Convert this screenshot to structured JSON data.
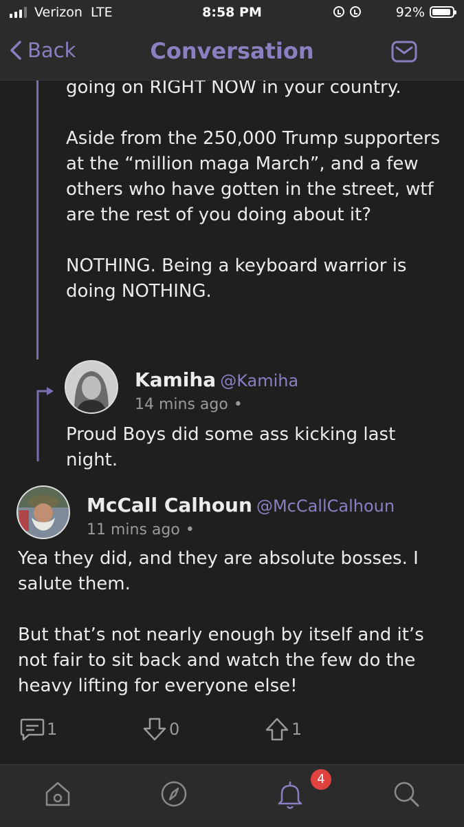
{
  "status_bar": {
    "carrier": "Verizon",
    "network": "LTE",
    "time": "8:58 PM",
    "battery_percent": "92%",
    "battery_level": 0.92,
    "signal_bars": 3,
    "icons": [
      "orientation-lock-icon",
      "alarm-icon"
    ]
  },
  "nav": {
    "back_label": "Back",
    "title": "Conversation",
    "compose_icon": "mail-icon"
  },
  "parent_post": {
    "paragraphs": [
      "going on RIGHT NOW in your country.",
      "Aside from the 250,000 Trump supporters at the “million maga March”, and a few others who have gotten in the street, wtf are the rest of you doing about it?",
      "NOTHING. Being a keyboard warrior is doing NOTHING."
    ]
  },
  "reply_one": {
    "name": "Kamiha",
    "handle": "@Kamiha",
    "time": "14 mins ago",
    "separator": "•",
    "text": "Proud Boys did some ass kicking last night."
  },
  "reply_two": {
    "name": "McCall Calhoun",
    "handle": "@McCallCalhoun",
    "time": "11 mins ago",
    "separator": "•",
    "paragraphs": [
      "Yea they did, and they are absolute bosses. I salute them.",
      "But that’s not nearly enough by itself and it’s not fair to sit back and watch the few do the heavy lifting for everyone else!"
    ],
    "comments": "1",
    "downvotes": "0",
    "upvotes": "1"
  },
  "tabbar": {
    "tabs": [
      "home-icon",
      "explore-icon",
      "notifications-icon",
      "search-icon"
    ],
    "notification_count": "4"
  },
  "colors": {
    "accent": "#8a7fc0",
    "background": "#1f1f1f",
    "bar": "#2b2b2b",
    "badge": "#e0433f"
  }
}
